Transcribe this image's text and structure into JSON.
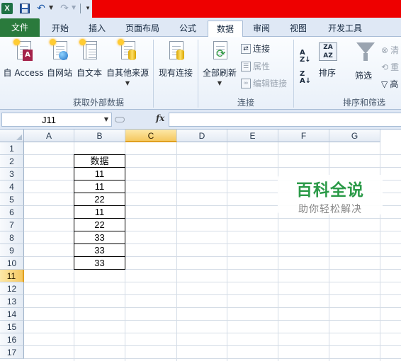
{
  "app": {
    "icon": "excel-logo-icon",
    "accent": "#1e7145",
    "title_bar_color": "#ee0000"
  },
  "quick_access": {
    "icons": [
      "save-icon",
      "undo-icon",
      "redo-icon",
      "customize-icon"
    ]
  },
  "tabs": [
    {
      "label": "文件",
      "kind": "file"
    },
    {
      "label": "开始"
    },
    {
      "label": "插入"
    },
    {
      "label": "页面布局"
    },
    {
      "label": "公式"
    },
    {
      "label": "数据",
      "active": true
    },
    {
      "label": "审阅"
    },
    {
      "label": "视图"
    },
    {
      "label": "开发工具"
    }
  ],
  "ribbon": {
    "groups": {
      "external": {
        "label": "获取外部数据",
        "buttons": [
          "自 Access",
          "自网站",
          "自文本",
          "自其他来源"
        ],
        "existing": "现有连接"
      },
      "connections": {
        "label": "连接",
        "refresh_all": "全部刷新",
        "connections": "连接",
        "properties": "属性",
        "edit_links": "编辑链接"
      },
      "sort_filter": {
        "label": "排序和筛选",
        "sort": "排序",
        "filter": "筛选",
        "clear": "清",
        "reapply": "重",
        "advanced": "高"
      }
    }
  },
  "formula_bar": {
    "name_box": "J11",
    "fx": "fx",
    "value": ""
  },
  "grid": {
    "columns": [
      "A",
      "B",
      "C",
      "D",
      "E",
      "F",
      "G"
    ],
    "selected_column": "C",
    "rows": [
      "1",
      "2",
      "3",
      "4",
      "5",
      "6",
      "7",
      "8",
      "9",
      "10",
      "11",
      "12",
      "13",
      "14",
      "15",
      "16",
      "17"
    ],
    "selected_row": "11",
    "table": {
      "header": "数据",
      "values": [
        "11",
        "11",
        "22",
        "11",
        "22",
        "33",
        "33",
        "33"
      ]
    }
  },
  "watermark": {
    "title": "百科全说",
    "subtitle": "助你轻松解决"
  }
}
